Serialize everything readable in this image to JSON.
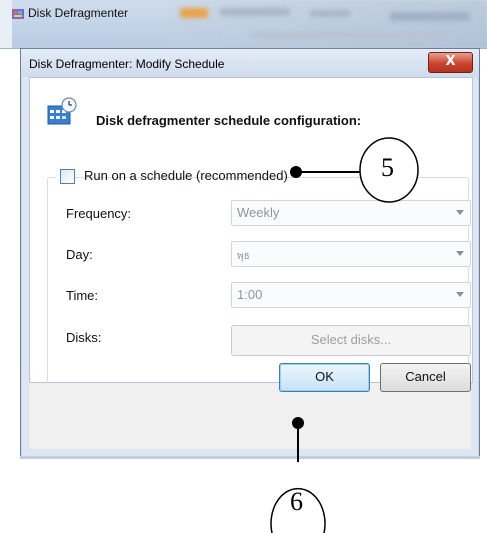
{
  "parent_window": {
    "title": "Disk Defragmenter"
  },
  "dialog": {
    "title": "Disk Defragmenter: Modify Schedule",
    "close_label": "X",
    "header": "Disk defragmenter schedule configuration:",
    "schedule_checkbox": {
      "label": "Run on a schedule (recommended)",
      "checked": false
    },
    "fields": {
      "frequency": {
        "label": "Frequency:",
        "value": "Weekly"
      },
      "day": {
        "label": "Day:",
        "value": "พุธ"
      },
      "time": {
        "label": "Time:",
        "value": "1:00"
      },
      "disks": {
        "label": "Disks:",
        "button": "Select disks..."
      }
    },
    "buttons": {
      "ok": "OK",
      "cancel": "Cancel"
    }
  },
  "annotations": {
    "callout_5": "5",
    "callout_6": "6"
  },
  "colors": {
    "accent": "#3c7fb1",
    "close": "#c8452f",
    "frame": "#dde6f2"
  }
}
